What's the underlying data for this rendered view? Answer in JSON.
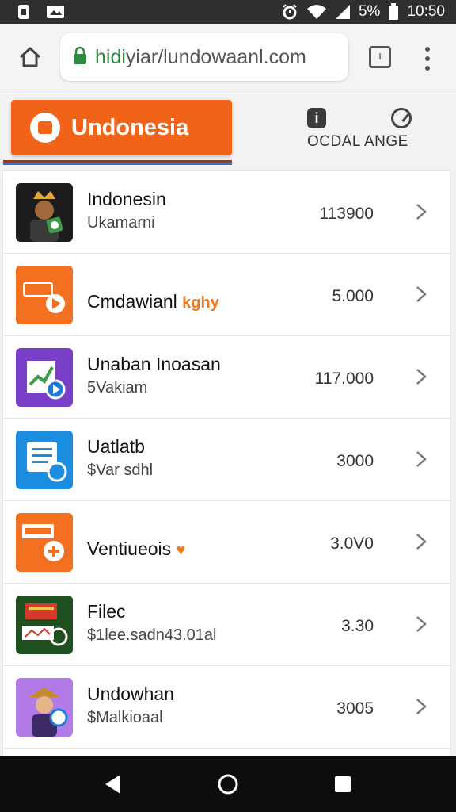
{
  "status_bar": {
    "battery": "5%",
    "time": "10:50",
    "icons": [
      "sim-icon",
      "image-icon",
      "alarm-icon",
      "wifi-icon",
      "signal-icon",
      "battery-icon"
    ]
  },
  "browser": {
    "url_domain": "hidi",
    "url_rest": "yiar/lundowaanl.com",
    "icons": [
      "home-icon",
      "lock-icon",
      "tabs-icon",
      "more-vert-icon"
    ]
  },
  "header": {
    "brand_label": "Undonesia",
    "tools_label": "OCDAL ANGE",
    "icons": [
      "info-icon",
      "gauge-icon"
    ]
  },
  "list": {
    "items": [
      {
        "title": "Indonesin",
        "subtitle": "Ukamarni",
        "tag": "",
        "value": "113900",
        "icon": "king-avatar-icon",
        "colors": [
          "#1c1c1c",
          "#e3a63a"
        ]
      },
      {
        "title": "Cmdawianl",
        "subtitle": "",
        "tag": "kghy",
        "value": "5.000",
        "icon": "video-play-icon",
        "colors": [
          "#f37021",
          "#ffffff"
        ]
      },
      {
        "title": "Unaban Inoasan",
        "subtitle": "5Vakiam",
        "tag": "",
        "value": "117.000",
        "icon": "document-chart-icon",
        "colors": [
          "#7a3fc9",
          "#ffffff"
        ]
      },
      {
        "title": "Uatlatb",
        "subtitle": "$Var sdhl",
        "tag": "",
        "value": "3000",
        "icon": "document-list-icon",
        "colors": [
          "#1d8de0",
          "#ffffff"
        ]
      },
      {
        "title": "Ventiueois",
        "subtitle": "",
        "tag": "♥",
        "value": "3.0V0",
        "icon": "add-box-icon",
        "colors": [
          "#f37021",
          "#ffffff"
        ]
      },
      {
        "title": "Filec",
        "subtitle": "$1lee.sadn43.01al",
        "tag": "",
        "value": "3.30",
        "icon": "money-icon",
        "colors": [
          "#1f4f1f",
          "#d33a2c"
        ]
      },
      {
        "title": "Undowhan",
        "subtitle": "$Malkioaal",
        "tag": "",
        "value": "3005",
        "icon": "person-avatar-icon",
        "colors": [
          "#b27be8",
          "#3b2a66"
        ]
      }
    ]
  },
  "nav_bar": {
    "icons": [
      "back-icon",
      "home-circle-icon",
      "recents-icon"
    ]
  }
}
